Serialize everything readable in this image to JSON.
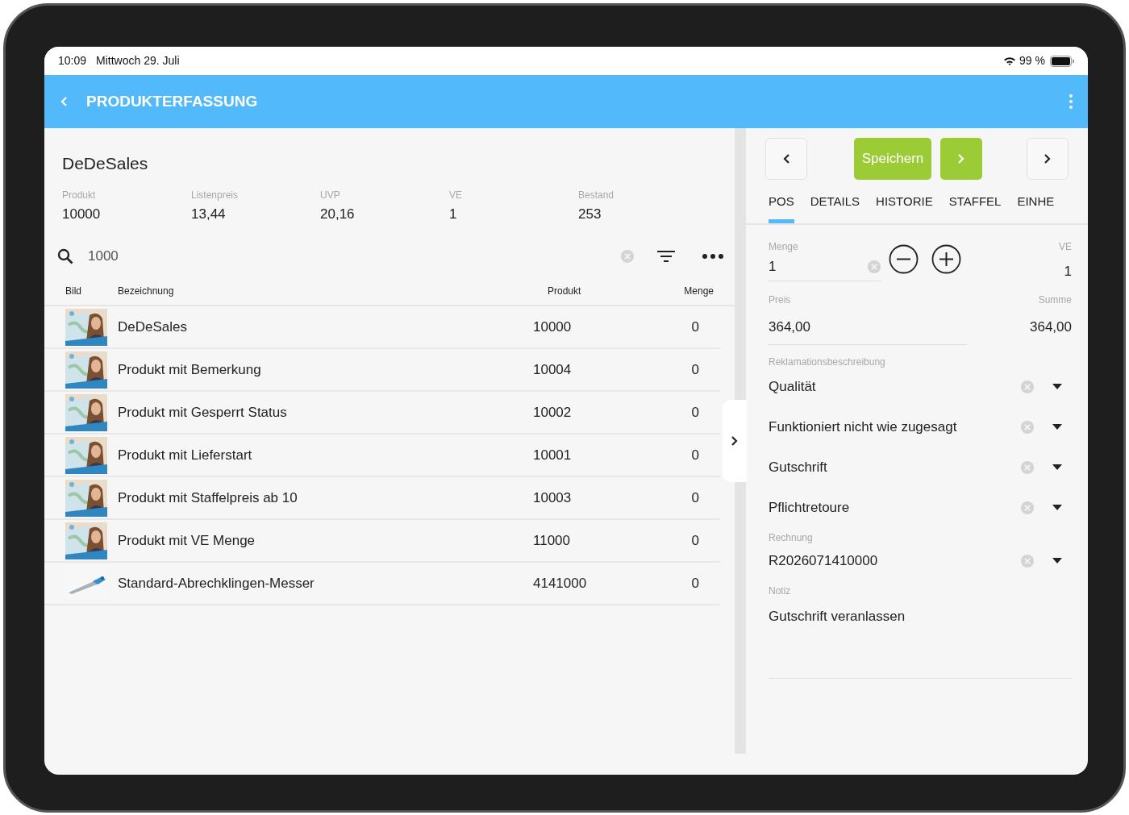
{
  "status_bar": {
    "time": "10:09",
    "date": "Mittwoch 29. Juli",
    "battery": "99 %"
  },
  "header": {
    "title": "PRODUKTERFASSUNG"
  },
  "product": {
    "name": "DeDeSales",
    "stats": [
      {
        "label": "Produkt",
        "value": "10000"
      },
      {
        "label": "Listenpreis",
        "value": "13,44"
      },
      {
        "label": "UVP",
        "value": "20,16"
      },
      {
        "label": "VE",
        "value": "1"
      },
      {
        "label": "Bestand",
        "value": "253"
      }
    ]
  },
  "search": {
    "value": "1000"
  },
  "table": {
    "columns": [
      "Bild",
      "Bezeichnung",
      "Produkt",
      "Menge"
    ],
    "rows": [
      {
        "name": "DeDeSales",
        "product": "10000",
        "qty": "0"
      },
      {
        "name": "Produkt mit Bemerkung",
        "product": "10004",
        "qty": "0"
      },
      {
        "name": "Produkt mit Gesperrt Status",
        "product": "10002",
        "qty": "0"
      },
      {
        "name": "Produkt mit Lieferstart",
        "product": "10001",
        "qty": "0"
      },
      {
        "name": "Produkt mit Staffelpreis ab 10",
        "product": "10003",
        "qty": "0"
      },
      {
        "name": "Produkt mit VE Menge",
        "product": "11000",
        "qty": "0"
      },
      {
        "kind": "tool",
        "name": "Standard-Abrechklingen-Messer",
        "product": "4141000",
        "qty": "0"
      }
    ]
  },
  "detail": {
    "save_button": "Speichern",
    "tabs": [
      {
        "label": "POS",
        "selected": true
      },
      {
        "label": "DETAILS",
        "selected": false
      },
      {
        "label": "HISTORIE",
        "selected": false
      },
      {
        "label": "STAFFEL",
        "selected": false
      },
      {
        "label": "EINHE",
        "selected": false
      }
    ],
    "menge": {
      "label": "Menge",
      "value": "1"
    },
    "ve": {
      "label": "VE",
      "value": "1"
    },
    "preis": {
      "label": "Preis",
      "value": "364,00"
    },
    "summe": {
      "label": "Summe",
      "value": "364,00"
    },
    "reklamation_label": "Reklamationsbeschreibung",
    "selects": [
      "Qualität",
      "Funktioniert nicht wie zugesagt",
      "Gutschrift",
      "Pflichtretoure"
    ],
    "rechnung": {
      "label": "Rechnung",
      "value": "R2026071410000"
    },
    "notiz": {
      "label": "Notiz",
      "value": "Gutschrift veranlassen"
    }
  }
}
